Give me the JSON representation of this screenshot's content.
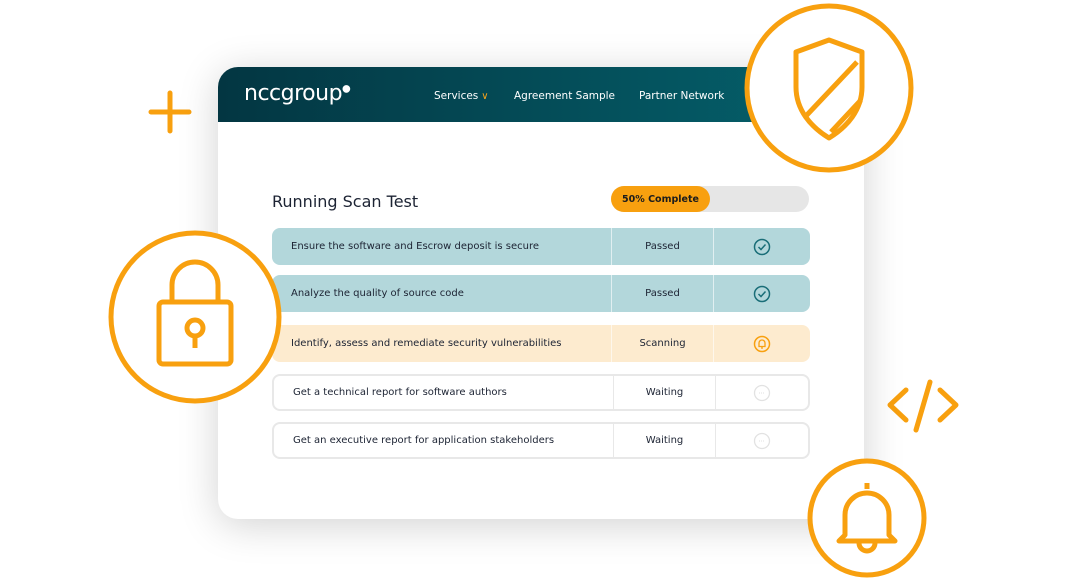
{
  "header": {
    "logo": "nccgroup",
    "nav": [
      {
        "label": "Services",
        "has_dropdown": true
      },
      {
        "label": "Agreement Sample"
      },
      {
        "label": "Partner Network"
      }
    ]
  },
  "main": {
    "title": "Running Scan Test",
    "progress": {
      "label": "50% Complete",
      "percent": 50
    },
    "rows": [
      {
        "task": "Ensure the software and Escrow deposit is secure",
        "status": "Passed",
        "icon": "check-circle-icon"
      },
      {
        "task": "Analyze the quality of source code",
        "status": "Passed",
        "icon": "check-circle-icon"
      },
      {
        "task": "Identify, assess and remediate security vulnerabilities",
        "status": "Scanning",
        "icon": "bell-icon"
      },
      {
        "task": "Get a technical report for software authors",
        "status": "Waiting",
        "icon": "ellipsis-circle-icon"
      },
      {
        "task": "Get an executive report for application stakeholders",
        "status": "Waiting",
        "icon": "ellipsis-circle-icon"
      }
    ]
  },
  "colors": {
    "accent": "#f8a00f",
    "header": "#043a46",
    "passed": "#b3d7db",
    "scanning": "#fdebcf"
  }
}
